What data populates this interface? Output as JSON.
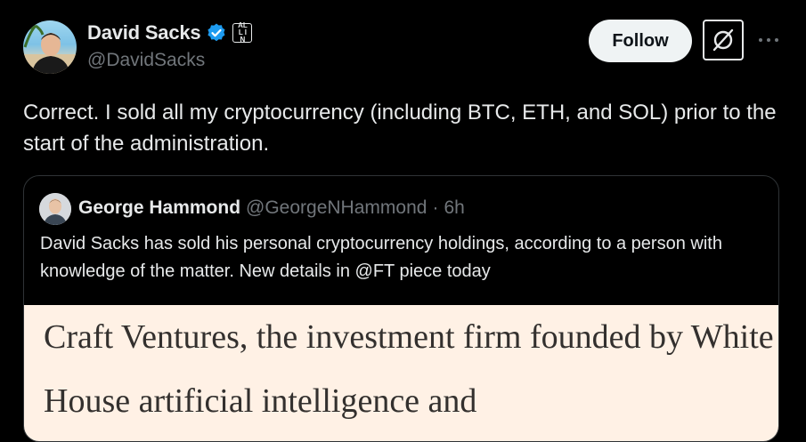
{
  "author": {
    "name": "David Sacks",
    "handle": "@DavidSacks",
    "verified_color": "#1d9bf0",
    "affiliate_badge_text": "ALL IN"
  },
  "actions": {
    "follow_label": "Follow",
    "grok_icon": "grok-icon",
    "more_icon": "more-icon"
  },
  "tweet": {
    "text": "Correct. I sold all my cryptocurrency (including BTC, ETH, and SOL) prior to the start of the administration."
  },
  "quote": {
    "name": "George Hammond",
    "handle": "@GeorgeNHammond",
    "separator": "·",
    "time": "6h",
    "text": "David Sacks has sold his personal cryptocurrency holdings, according to a person with knowledge of the matter. New details in @FT piece today",
    "image_text": "Craft Ventures, the investment firm founded by White House artificial intelligence and"
  },
  "colors": {
    "background": "#000000",
    "text": "#e7e9ea",
    "muted": "#71767b",
    "border": "#2f3336",
    "ft_paper": "#fff1e5"
  }
}
